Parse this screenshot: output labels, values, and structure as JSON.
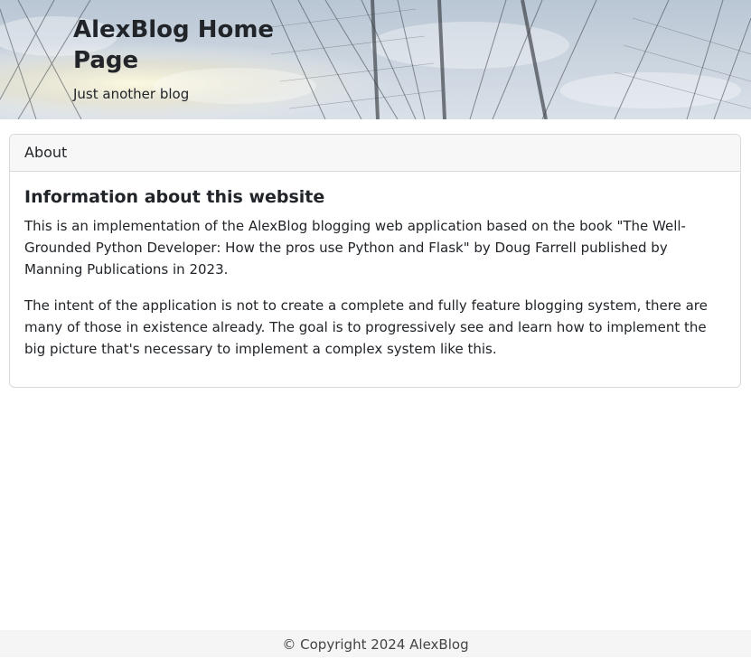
{
  "header": {
    "title": "AlexBlog Home Page",
    "tagline": "Just another blog"
  },
  "about_card": {
    "header": "About",
    "title": "Information about this website",
    "paragraphs": [
      "This is an implementation of the AlexBlog blogging web application based on the book \"The Well-Grounded Python Developer: How the pros use Python and Flask\" by Doug Farrell published by Manning Publications in 2023.",
      "The intent of the application is not to create a complete and fully feature blogging system, there are many of those in existence already. The goal is to progressively see and learn how to implement the big picture that's necessary to implement a complex system like this."
    ]
  },
  "footer": {
    "copyright": "© Copyright 2024 AlexBlog"
  },
  "colors": {
    "text": "#212529",
    "card_border": "#d9d9d9",
    "card_header_bg": "#f7f7f7",
    "footer_bg": "#f5f5f5"
  }
}
